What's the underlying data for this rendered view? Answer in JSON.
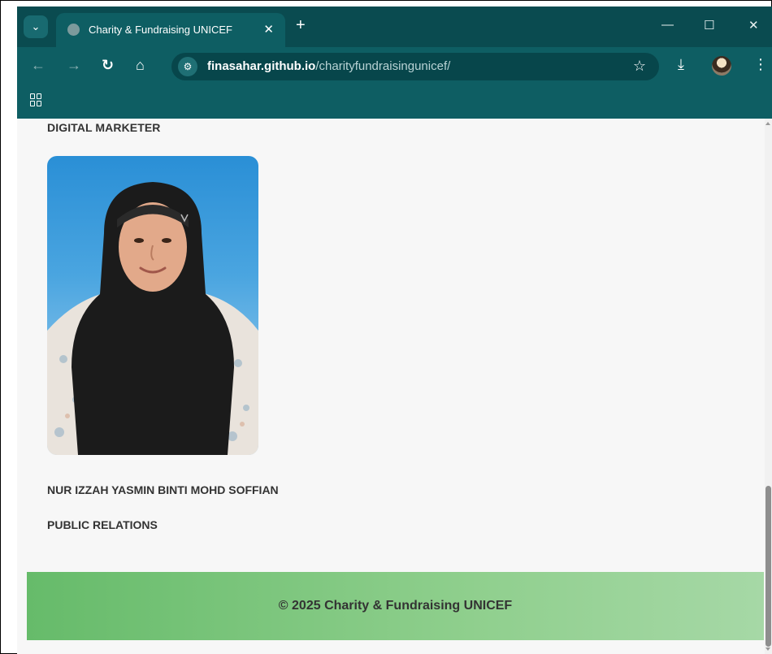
{
  "browser": {
    "tab_title": "Charity & Fundraising UNICEF",
    "tab_close": "✕",
    "new_tab": "+",
    "url_domain": "finasahar.github.io",
    "url_path": "/charityfundraisingunicef/",
    "minimize": "—",
    "maximize": "☐",
    "close": "✕",
    "back": "←",
    "forward": "→",
    "reload": "↻",
    "home": "⌂",
    "star": "☆",
    "download": "⤓",
    "menu": "⋮",
    "tab_search": "⌄",
    "site_info": "⚙"
  },
  "page": {
    "previous_role": "DIGITAL MARKETER",
    "member": {
      "name": "NUR IZZAH YASMIN BINTI MOHD SOFFIAN",
      "role": "PUBLIC RELATIONS"
    },
    "footer": "© 2025 Charity & Fundraising UNICEF"
  },
  "colors": {
    "chrome": "#0e5e63",
    "tabbar": "#0a4b50",
    "footer_start": "#66bb6a",
    "footer_end": "#a6d8a6",
    "photo_background": "#2a8fd6",
    "hijab": "#1a1a1a"
  }
}
